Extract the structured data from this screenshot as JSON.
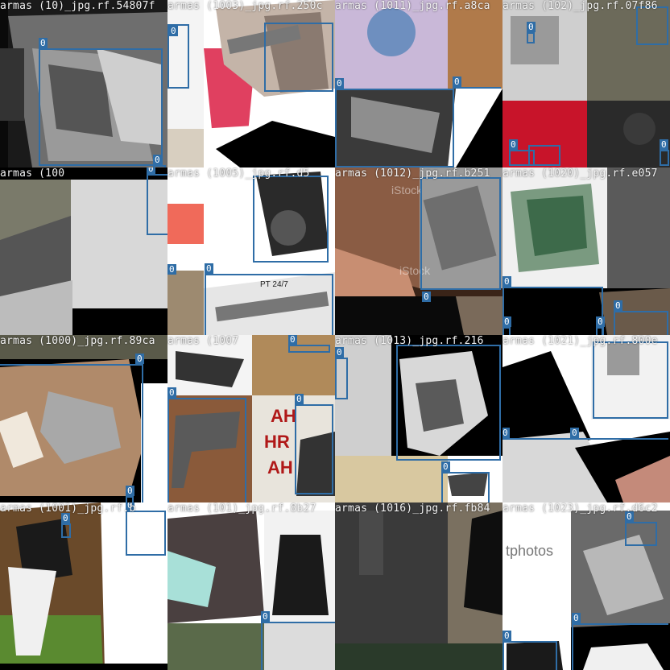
{
  "box_color": "#2f6da6",
  "cells": [
    {
      "file": "armas (10)_jpg.rf.54807f",
      "labels": [
        "0",
        "0"
      ]
    },
    {
      "file": "armas (1003)_jpg.rf.250c",
      "labels": [
        "0"
      ]
    },
    {
      "file": "armas (1011)_jpg.rf.a8ca",
      "labels": [
        "0",
        "0"
      ]
    },
    {
      "file": "armas (102)_jpg.rf.07f86",
      "labels": [
        "0",
        "0",
        "0",
        "0",
        "0"
      ]
    },
    {
      "file": "armas (100",
      "labels": [
        "0"
      ]
    },
    {
      "file": "armas (1005)_jpg.rf.d5",
      "labels": [
        "0",
        "0"
      ]
    },
    {
      "file": "armas (1012)_jpg.rf.b251",
      "labels": [
        "0"
      ]
    },
    {
      "file": "armas (1020)_jpg.rf.e057",
      "labels": [
        "0",
        "0",
        "0",
        "0"
      ]
    },
    {
      "file": "armas (1000)_jpg.rf.89ca",
      "labels": [
        "0",
        "0"
      ]
    },
    {
      "file": "armas (1007",
      "labels": [
        "0",
        "0",
        "0"
      ]
    },
    {
      "file": "armas (1013)_jpg.rf.216",
      "labels": [
        "0",
        "0"
      ]
    },
    {
      "file": "armas (1021)_jpg.rf.800e",
      "labels": [
        "0",
        "0"
      ]
    },
    {
      "file": "armas (1001)_jpg.rf.b",
      "labels": [
        "0",
        "0"
      ]
    },
    {
      "file": "armas (101)_jpg.rf.8b27",
      "labels": [
        "0"
      ]
    },
    {
      "file": "armas (1016)_jpg.rf.fb84",
      "labels": []
    },
    {
      "file": "armas (1023)_jpg.rf.d6c2",
      "labels": [
        "0",
        "0",
        "0"
      ]
    }
  ],
  "watermarks": {
    "c6_top": "iStock",
    "c6_mid": "iStock",
    "c15_text": "tphotos",
    "c5_stamp": "PT 24/7"
  },
  "graffiti": [
    "AH",
    "HR",
    "AH"
  ]
}
